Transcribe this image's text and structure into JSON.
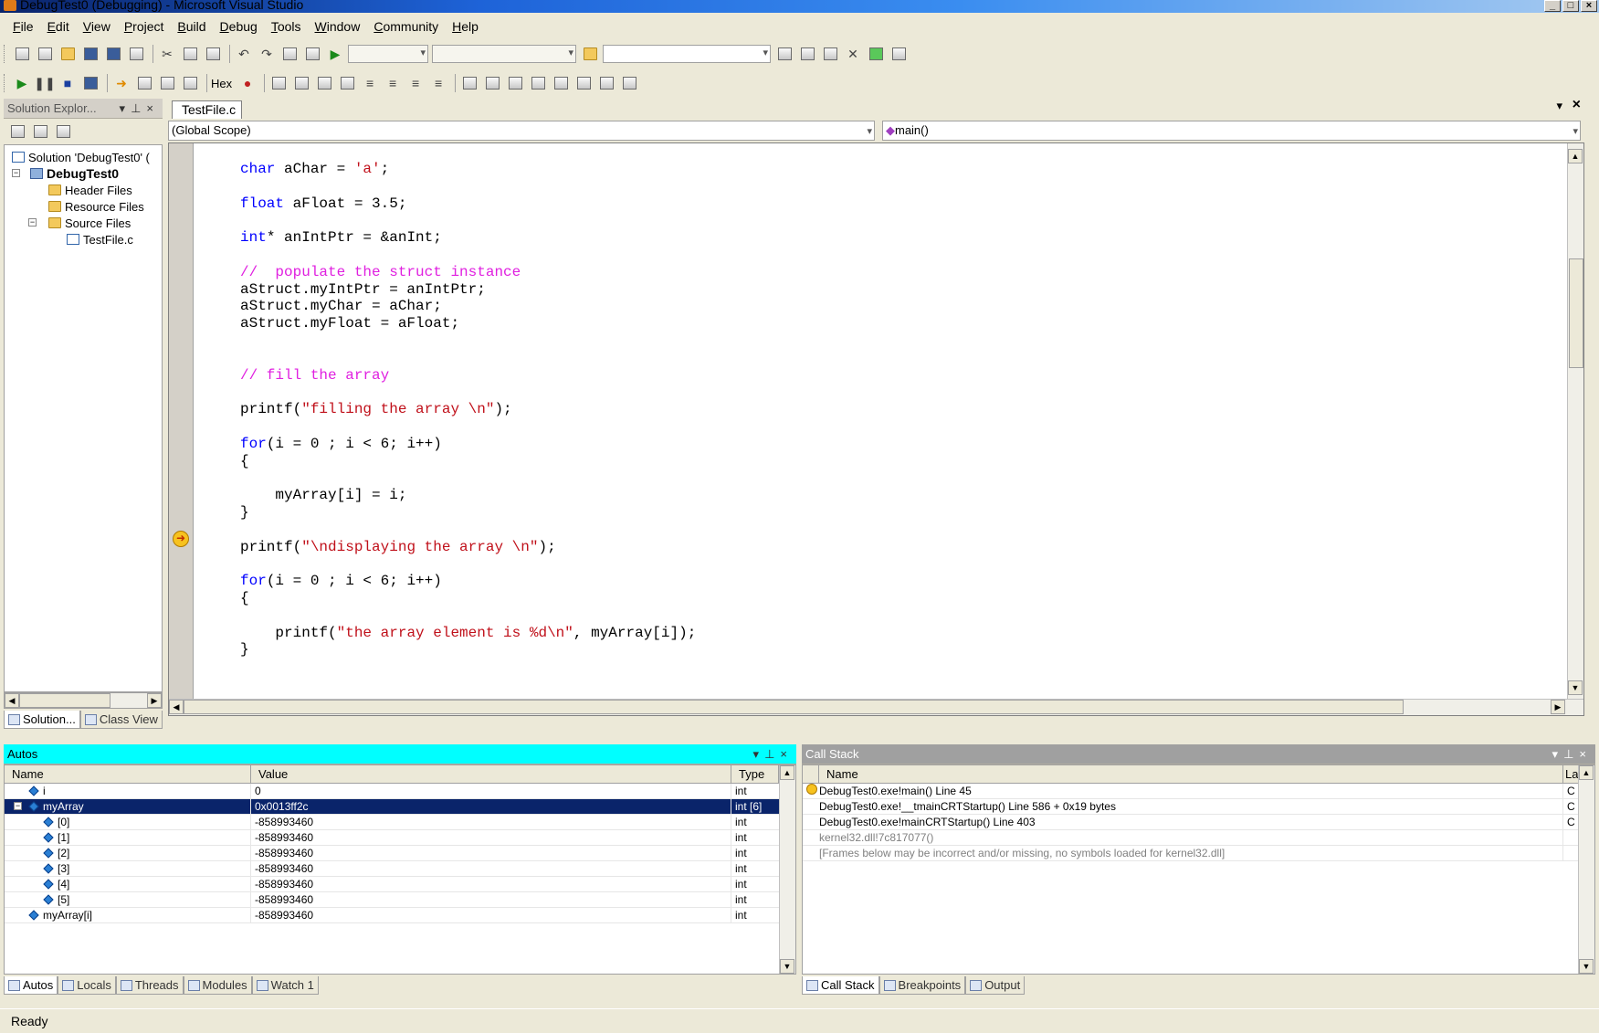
{
  "window": {
    "title": "DebugTest0 (Debugging) - Microsoft Visual Studio",
    "min": "_",
    "max": "□",
    "close": "×"
  },
  "menu": [
    "File",
    "Edit",
    "View",
    "Project",
    "Build",
    "Debug",
    "Tools",
    "Window",
    "Community",
    "Help"
  ],
  "debug_toolbar": {
    "hex_label": "Hex"
  },
  "solution_explorer": {
    "title": "Solution Explor...",
    "items": [
      "Solution 'DebugTest0' (",
      "DebugTest0",
      "Header Files",
      "Resource Files",
      "Source Files",
      "TestFile.c"
    ],
    "tabs": [
      "Solution...",
      "Class View"
    ]
  },
  "editor": {
    "tab": "TestFile.c",
    "scope": "(Global Scope)",
    "function": "main()",
    "lines": [
      [
        {
          "t": "char",
          "c": "kw"
        },
        {
          "t": " aChar = "
        },
        {
          "t": "'a'",
          "c": "st"
        },
        {
          "t": ";"
        }
      ],
      [],
      [
        {
          "t": "float",
          "c": "kw"
        },
        {
          "t": " aFloat = 3.5;"
        }
      ],
      [],
      [
        {
          "t": "int",
          "c": "kw"
        },
        {
          "t": "* anIntPtr = &anInt;"
        }
      ],
      [],
      [
        {
          "t": "//  populate the struct instance",
          "c": "cm"
        }
      ],
      [
        {
          "t": "aStruct.myIntPtr = anIntPtr;"
        }
      ],
      [
        {
          "t": "aStruct.myChar = aChar;"
        }
      ],
      [
        {
          "t": "aStruct.myFloat = aFloat;"
        }
      ],
      [],
      [],
      [
        {
          "t": "// fill the array",
          "c": "cm"
        }
      ],
      [],
      [
        {
          "t": "printf("
        },
        {
          "t": "\"filling the array \\n\"",
          "c": "st"
        },
        {
          "t": ");"
        }
      ],
      [],
      [
        {
          "t": "for",
          "c": "kw"
        },
        {
          "t": "(i = 0 ; i < 6; i++)"
        }
      ],
      [
        {
          "t": "{"
        }
      ],
      [],
      [
        {
          "t": "    myArray[i] = i;"
        }
      ],
      [
        {
          "t": "}"
        }
      ],
      [],
      [
        {
          "t": "printf("
        },
        {
          "t": "\"\\ndisplaying the array \\n\"",
          "c": "st"
        },
        {
          "t": ");"
        }
      ],
      [],
      [
        {
          "t": "for",
          "c": "kw"
        },
        {
          "t": "(i = 0 ; i < 6; i++)"
        }
      ],
      [
        {
          "t": "{"
        }
      ],
      [],
      [
        {
          "t": "    printf("
        },
        {
          "t": "\"the array element is %d\\n\"",
          "c": "st"
        },
        {
          "t": ", myArray[i]);"
        }
      ],
      [
        {
          "t": "}"
        }
      ]
    ]
  },
  "autos": {
    "title": "Autos",
    "columns": [
      "Name",
      "Value",
      "Type"
    ],
    "rows": [
      {
        "name": "i",
        "value": "0",
        "type": "int",
        "level": 0
      },
      {
        "name": "myArray",
        "value": "0x0013ff2c",
        "type": "int [6]",
        "level": 0,
        "expanded": true,
        "selected": true
      },
      {
        "name": "[0]",
        "value": "-858993460",
        "type": "int",
        "level": 1
      },
      {
        "name": "[1]",
        "value": "-858993460",
        "type": "int",
        "level": 1
      },
      {
        "name": "[2]",
        "value": "-858993460",
        "type": "int",
        "level": 1
      },
      {
        "name": "[3]",
        "value": "-858993460",
        "type": "int",
        "level": 1
      },
      {
        "name": "[4]",
        "value": "-858993460",
        "type": "int",
        "level": 1
      },
      {
        "name": "[5]",
        "value": "-858993460",
        "type": "int",
        "level": 1
      },
      {
        "name": "myArray[i]",
        "value": "-858993460",
        "type": "int",
        "level": 0
      }
    ],
    "tabs": [
      "Autos",
      "Locals",
      "Threads",
      "Modules",
      "Watch 1"
    ]
  },
  "callstack": {
    "title": "Call Stack",
    "columns": [
      "Name",
      "Lang"
    ],
    "rows": [
      {
        "name": "DebugTest0.exe!main()  Line 45",
        "lang": "C",
        "current": true
      },
      {
        "name": "DebugTest0.exe!__tmainCRTStartup()  Line 586 + 0x19 bytes",
        "lang": "C"
      },
      {
        "name": "DebugTest0.exe!mainCRTStartup()  Line 403",
        "lang": "C"
      },
      {
        "name": "kernel32.dll!7c817077()",
        "lang": "",
        "gray": true
      },
      {
        "name": "[Frames below may be incorrect and/or missing, no symbols loaded for kernel32.dll]",
        "lang": "",
        "gray": true
      }
    ],
    "tabs": [
      "Call Stack",
      "Breakpoints",
      "Output"
    ]
  },
  "status": "Ready"
}
